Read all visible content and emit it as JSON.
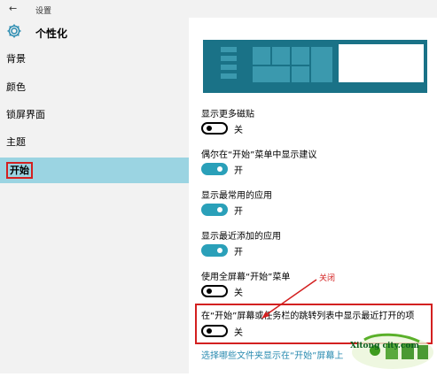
{
  "window": {
    "back_glyph": "←",
    "title": "设置"
  },
  "header": {
    "icon": "gear-icon",
    "title": "个性化"
  },
  "sidebar": {
    "items": [
      {
        "label": "背景"
      },
      {
        "label": "颜色"
      },
      {
        "label": "锁屏界面"
      },
      {
        "label": "主题"
      },
      {
        "label": "开始",
        "selected": true
      }
    ]
  },
  "settings": [
    {
      "label": "显示更多磁贴",
      "state": "关",
      "on": false
    },
    {
      "label": "偶尔在“开始”菜单中显示建议",
      "state": "开",
      "on": true
    },
    {
      "label": "显示最常用的应用",
      "state": "开",
      "on": true
    },
    {
      "label": "显示最近添加的应用",
      "state": "开",
      "on": true
    },
    {
      "label": "使用全屏幕“开始”菜单",
      "state": "关",
      "on": false
    },
    {
      "label": "在“开始”屏幕或任务栏的跳转列表中显示最近打开的项",
      "state": "关",
      "on": false
    }
  ],
  "annotation": {
    "text": "关闭",
    "color": "#d32020"
  },
  "link": {
    "text": "选择哪些文件夹显示在“开始”屏幕上"
  },
  "watermark": {
    "text": "Xitong city.com"
  },
  "colors": {
    "accent": "#2aa0b9",
    "selected_bg": "#9bd4e2",
    "sidebar_bg": "#f2f2f2",
    "highlight": "#d32020"
  }
}
